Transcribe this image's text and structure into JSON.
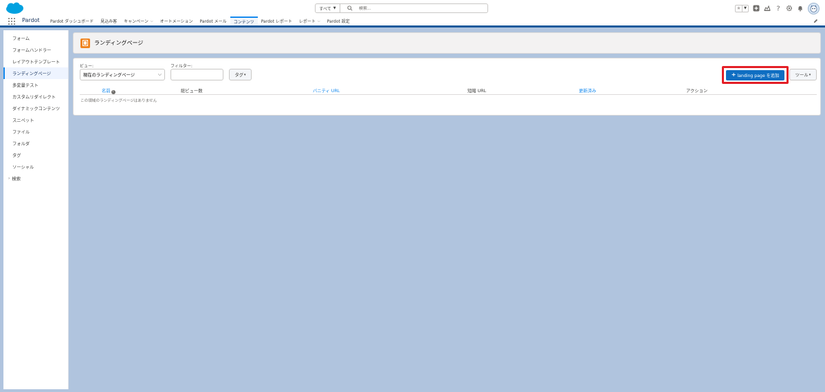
{
  "header": {
    "search": {
      "scope": "すべて",
      "placeholder": "検索..."
    },
    "icons": [
      "favorites-star-icon",
      "chevron-down-icon",
      "add-icon",
      "trailhead-icon",
      "help-icon",
      "settings-gear-icon",
      "notifications-bell-icon",
      "avatar"
    ]
  },
  "nav": {
    "app_name": "Pardot",
    "tabs": [
      {
        "label": "Pardot ダッシュボード",
        "dropdown": false
      },
      {
        "label": "見込み客",
        "dropdown": false
      },
      {
        "label": "キャンペーン",
        "dropdown": true
      },
      {
        "label": "オートメーション",
        "dropdown": false
      },
      {
        "label": "Pardot メール",
        "dropdown": false
      },
      {
        "label": "コンテンツ",
        "dropdown": false,
        "active": true
      },
      {
        "label": "Pardot レポート",
        "dropdown": false
      },
      {
        "label": "レポート",
        "dropdown": true
      },
      {
        "label": "Pardot 設定",
        "dropdown": false
      }
    ]
  },
  "sidebar": {
    "items": [
      {
        "label": "フォーム"
      },
      {
        "label": "フォームハンドラー"
      },
      {
        "label": "レイアウトテンプレート"
      },
      {
        "label": "ランディングページ",
        "active": true
      },
      {
        "label": "多変量テスト"
      },
      {
        "label": "カスタムリダイレクト"
      },
      {
        "label": "ダイナミックコンテンツ"
      },
      {
        "label": "スニペット"
      },
      {
        "label": "ファイル"
      },
      {
        "label": "フォルダ"
      },
      {
        "label": "タグ"
      },
      {
        "label": "ソーシャル"
      }
    ],
    "search_label": "検索"
  },
  "page": {
    "title": "ランディングページ",
    "icon": "landing-page-icon",
    "icon_color": "#f0841f"
  },
  "toolbar": {
    "view_label": "ビュー:",
    "view_value": "現在のランディングページ",
    "filter_label": "フィルター:",
    "filter_value": "",
    "tag_label": "タグ",
    "add_label": "landing page を追加",
    "tools_label": "ツール"
  },
  "table": {
    "columns": [
      {
        "label": "名前",
        "sortable": true
      },
      {
        "label": "総ビュー数",
        "sortable": false
      },
      {
        "label": "バニティ URL",
        "sortable": true
      },
      {
        "label": "短縮 URL",
        "sortable": false
      },
      {
        "label": "更新済み",
        "sortable": true
      },
      {
        "label": "アクション",
        "sortable": false
      }
    ],
    "empty_message": "この領域のランディングページはありません"
  },
  "colors": {
    "brand_blue": "#0f6ec2",
    "highlight_red": "#e41e26",
    "link_blue": "#1589ee",
    "background": "#b0c4de"
  }
}
